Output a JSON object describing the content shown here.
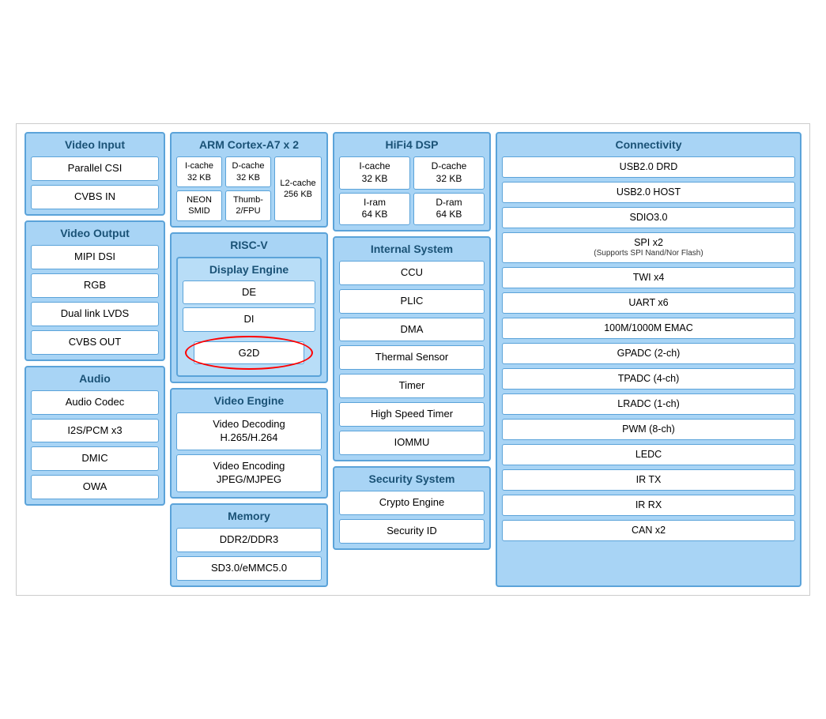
{
  "videoInput": {
    "title": "Video Input",
    "items": [
      "Parallel CSI",
      "CVBS IN"
    ]
  },
  "videoOutput": {
    "title": "Video Output",
    "items": [
      "MIPI DSI",
      "RGB",
      "Dual link LVDS",
      "CVBS OUT"
    ]
  },
  "audio": {
    "title": "Audio",
    "items": [
      "Audio Codec",
      "I2S/PCM x3",
      "DMIC",
      "OWA"
    ]
  },
  "armCortex": {
    "title": "ARM Cortex-A7 x 2",
    "icache": "I-cache\n32 KB",
    "dcache": "D-cache\n32 KB",
    "neon": "NEON\nSMID",
    "thumb": "Thumb-\n2/FPU",
    "l2cache": "L2-cache\n256 KB"
  },
  "riscv": {
    "title": "RISC-V"
  },
  "displayEngine": {
    "title": "Display Engine",
    "items": [
      "DE",
      "DI",
      "G2D"
    ]
  },
  "videoEngine": {
    "title": "Video Engine",
    "items": [
      "Video Decoding\nH.265/H.264",
      "Video Encoding\nJPEG/MJPEG"
    ]
  },
  "memory": {
    "title": "Memory",
    "items": [
      "DDR2/DDR3",
      "SD3.0/eMMC5.0"
    ]
  },
  "hifi4": {
    "title": "HiFi4 DSP",
    "icache": "I-cache\n32 KB",
    "dcache": "D-cache\n32 KB",
    "iram": "I-ram\n64 KB",
    "dram": "D-ram\n64 KB"
  },
  "internalSystem": {
    "title": "Internal System",
    "items": [
      "CCU",
      "PLIC",
      "DMA",
      "Thermal Sensor",
      "Timer",
      "High Speed Timer",
      "IOMMU"
    ]
  },
  "securitySystem": {
    "title": "Security System",
    "items": [
      "Crypto Engine",
      "Security ID"
    ]
  },
  "connectivity": {
    "title": "Connectivity",
    "items": [
      "USB2.0 DRD",
      "USB2.0 HOST",
      "SDIO3.0",
      "SPI x2",
      "(Supports SPI Nand/Nor Flash)",
      "TWI x4",
      "UART x6",
      "100M/1000M EMAC",
      "GPADC (2-ch)",
      "TPADC (4-ch)",
      "LRADC (1-ch)",
      "PWM (8-ch)",
      "LEDC",
      "IR TX",
      "IR RX",
      "CAN x2"
    ]
  }
}
